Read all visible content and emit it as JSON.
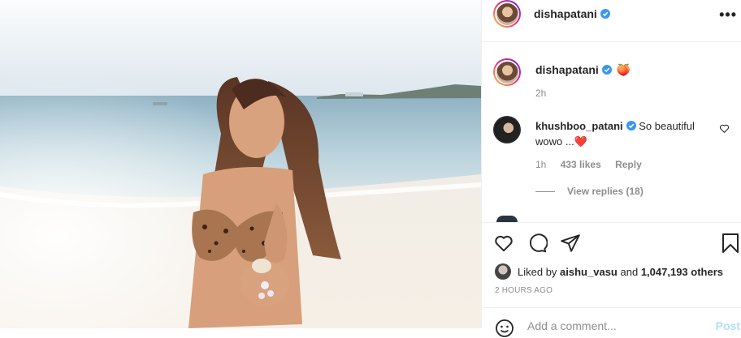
{
  "post": {
    "author": "dishapatani",
    "more_label": "•••",
    "image_alt": "photo"
  },
  "caption": {
    "username": "dishapatani",
    "emoji": "🍑",
    "time": "2h"
  },
  "comments": [
    {
      "username": "khushboo_patani",
      "text": "So beautiful wowo ...",
      "emoji": "❤️",
      "time": "1h",
      "likes": "433 likes",
      "reply_label": "Reply",
      "view_replies": "View replies (18)"
    }
  ],
  "actions": {
    "liked_by_prefix": "Liked by",
    "liked_by_user": "aishu_vasu",
    "and": "and",
    "others": "1,047,193 others",
    "posted_ago": "2 HOURS AGO"
  },
  "add_comment": {
    "placeholder": "Add a comment...",
    "post_label": "Post"
  },
  "colors": {
    "verified": "#3897f0",
    "post_disabled": "#b2dffc",
    "heart": "#ed4956"
  }
}
